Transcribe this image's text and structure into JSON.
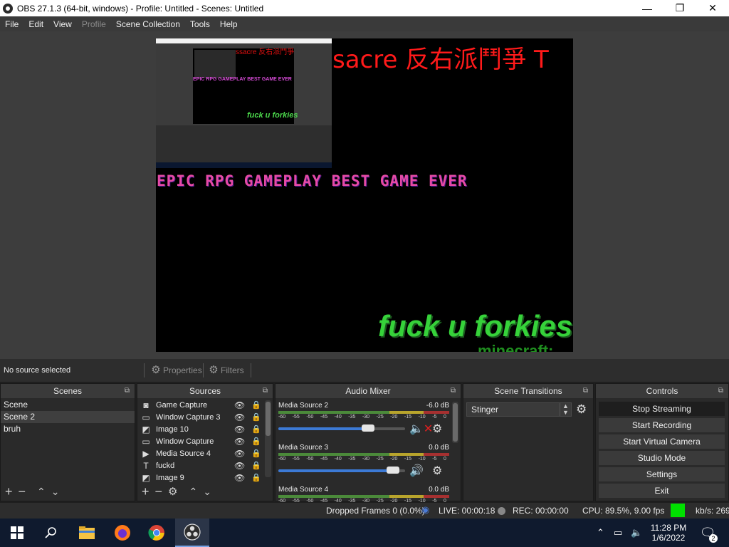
{
  "window": {
    "title": "OBS 27.1.3 (64-bit, windows) - Profile: Untitled - Scenes: Untitled",
    "minimize": "—",
    "maximize": "❐",
    "close": "✕"
  },
  "menu": [
    "File",
    "Edit",
    "View",
    "Profile",
    "Scene Collection",
    "Tools",
    "Help"
  ],
  "preview": {
    "red_text": "sacre 反右派鬥爭 T",
    "epic_text": "EPIC RPG GAMEPLAY BEST GAME EVER",
    "green_text": "fuck u forkies",
    "mc_text": "minecraft:",
    "nested_red": "ssacre 反右派鬥爭",
    "nested_epic": "EPIC RPG GAMEPLAY BEST GAME EVER",
    "nested_green": "fuck u forkies"
  },
  "source_toolbar": {
    "no_source": "No source selected",
    "properties": "Properties",
    "filters": "Filters"
  },
  "scenes": {
    "title": "Scenes",
    "items": [
      "Scene",
      "Scene 2",
      "bruh"
    ],
    "selected": "Scene 2"
  },
  "sources": {
    "title": "Sources",
    "items": [
      {
        "icon": "gamepad-icon",
        "glyph": "◙",
        "label": "Game Capture"
      },
      {
        "icon": "window-icon",
        "glyph": "▭",
        "label": "Window Capture 3"
      },
      {
        "icon": "image-icon",
        "glyph": "◩",
        "label": "Image 10"
      },
      {
        "icon": "window-icon",
        "glyph": "▭",
        "label": "Window Capture"
      },
      {
        "icon": "play-icon",
        "glyph": "▶",
        "label": "Media Source 4"
      },
      {
        "icon": "text-icon",
        "glyph": "T",
        "label": "fuckd"
      },
      {
        "icon": "image-icon",
        "glyph": "◩",
        "label": "Image 9"
      }
    ]
  },
  "mixer": {
    "title": "Audio Mixer",
    "channels": [
      {
        "name": "Media Source 2",
        "db": "-6.0 dB",
        "level": 0.73,
        "muted": true
      },
      {
        "name": "Media Source 3",
        "db": "0.0 dB",
        "level": 0.95,
        "muted": false
      },
      {
        "name": "Media Source 4",
        "db": "0.0 dB",
        "level": 0.95,
        "muted": false
      }
    ],
    "ticks": [
      "-60",
      "-55",
      "-50",
      "-45",
      "-40",
      "-35",
      "-30",
      "-25",
      "-20",
      "-15",
      "-10",
      "-5",
      "0"
    ]
  },
  "transitions": {
    "title": "Scene Transitions",
    "selected": "Stinger"
  },
  "controls": {
    "title": "Controls",
    "buttons": [
      "Stop Streaming",
      "Start Recording",
      "Start Virtual Camera",
      "Studio Mode",
      "Settings",
      "Exit"
    ]
  },
  "status": {
    "dropped": "Dropped Frames 0 (0.0%)",
    "live": "LIVE: 00:00:18",
    "rec": "REC: 00:00:00",
    "cpu": "CPU: 89.5%, 9.00 fps",
    "kbps": "kb/s: 269",
    "indicator_color": "#00e000"
  },
  "taskbar": {
    "time": "11:28 PM",
    "date": "1/6/2022",
    "notif_count": "2"
  },
  "colors": {
    "accent": "#3c7ad6",
    "muted_red": "#e02020"
  }
}
